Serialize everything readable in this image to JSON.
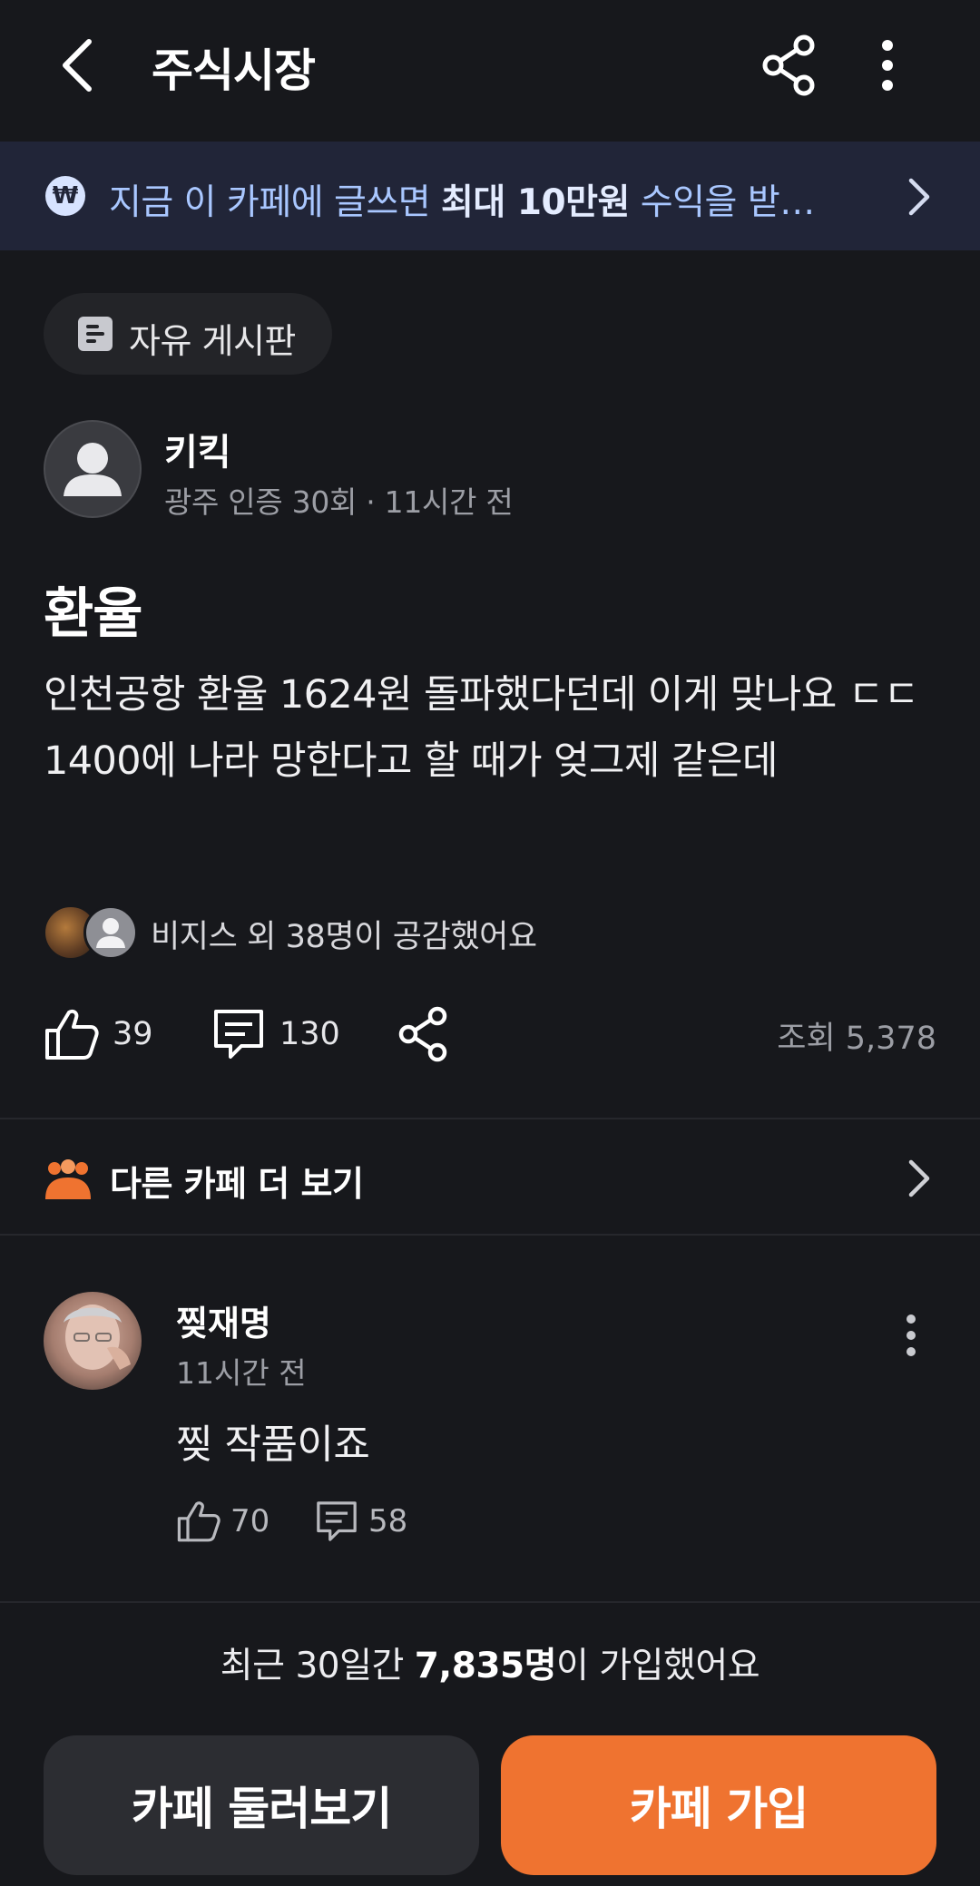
{
  "header": {
    "title": "주식시장"
  },
  "banner": {
    "text_prefix": "지금 이 카페에 글쓰면 ",
    "text_bold": "최대 10만원",
    "text_suffix": " 수익을 받…",
    "icon_glyph": "₩"
  },
  "board": {
    "label": "자유 게시판"
  },
  "author": {
    "name": "키킥",
    "meta": "광주 인증 30회 · 11시간 전"
  },
  "post": {
    "title": "환율",
    "body": "인천공항 환율 1624원 돌파했다던데 이게 맞나요 ㄷㄷ 1400에 나라 망한다고 할 때가 엊그제 같은데"
  },
  "likers": {
    "text": "비지스 외 38명이 공감했어요"
  },
  "actions": {
    "likes": "39",
    "comments": "130",
    "views": "조회 5,378"
  },
  "other_cafe": {
    "label": "다른 카페 더 보기"
  },
  "comment": {
    "name": "찢재명",
    "time": "11시간 전",
    "body": "찢 작품이죠",
    "likes": "70",
    "replies": "58"
  },
  "footer": {
    "joined_prefix": "최근 30일간 ",
    "joined_bold": "7,835명",
    "joined_suffix": "이 가입했어요",
    "browse_button": "카페 둘러보기",
    "join_button": "카페 가입"
  },
  "colors": {
    "background": "#17181c",
    "banner_bg": "#212538",
    "banner_text": "#a9c7ff",
    "join_accent": "#ef7330",
    "secondary_button": "#2c2d32"
  }
}
